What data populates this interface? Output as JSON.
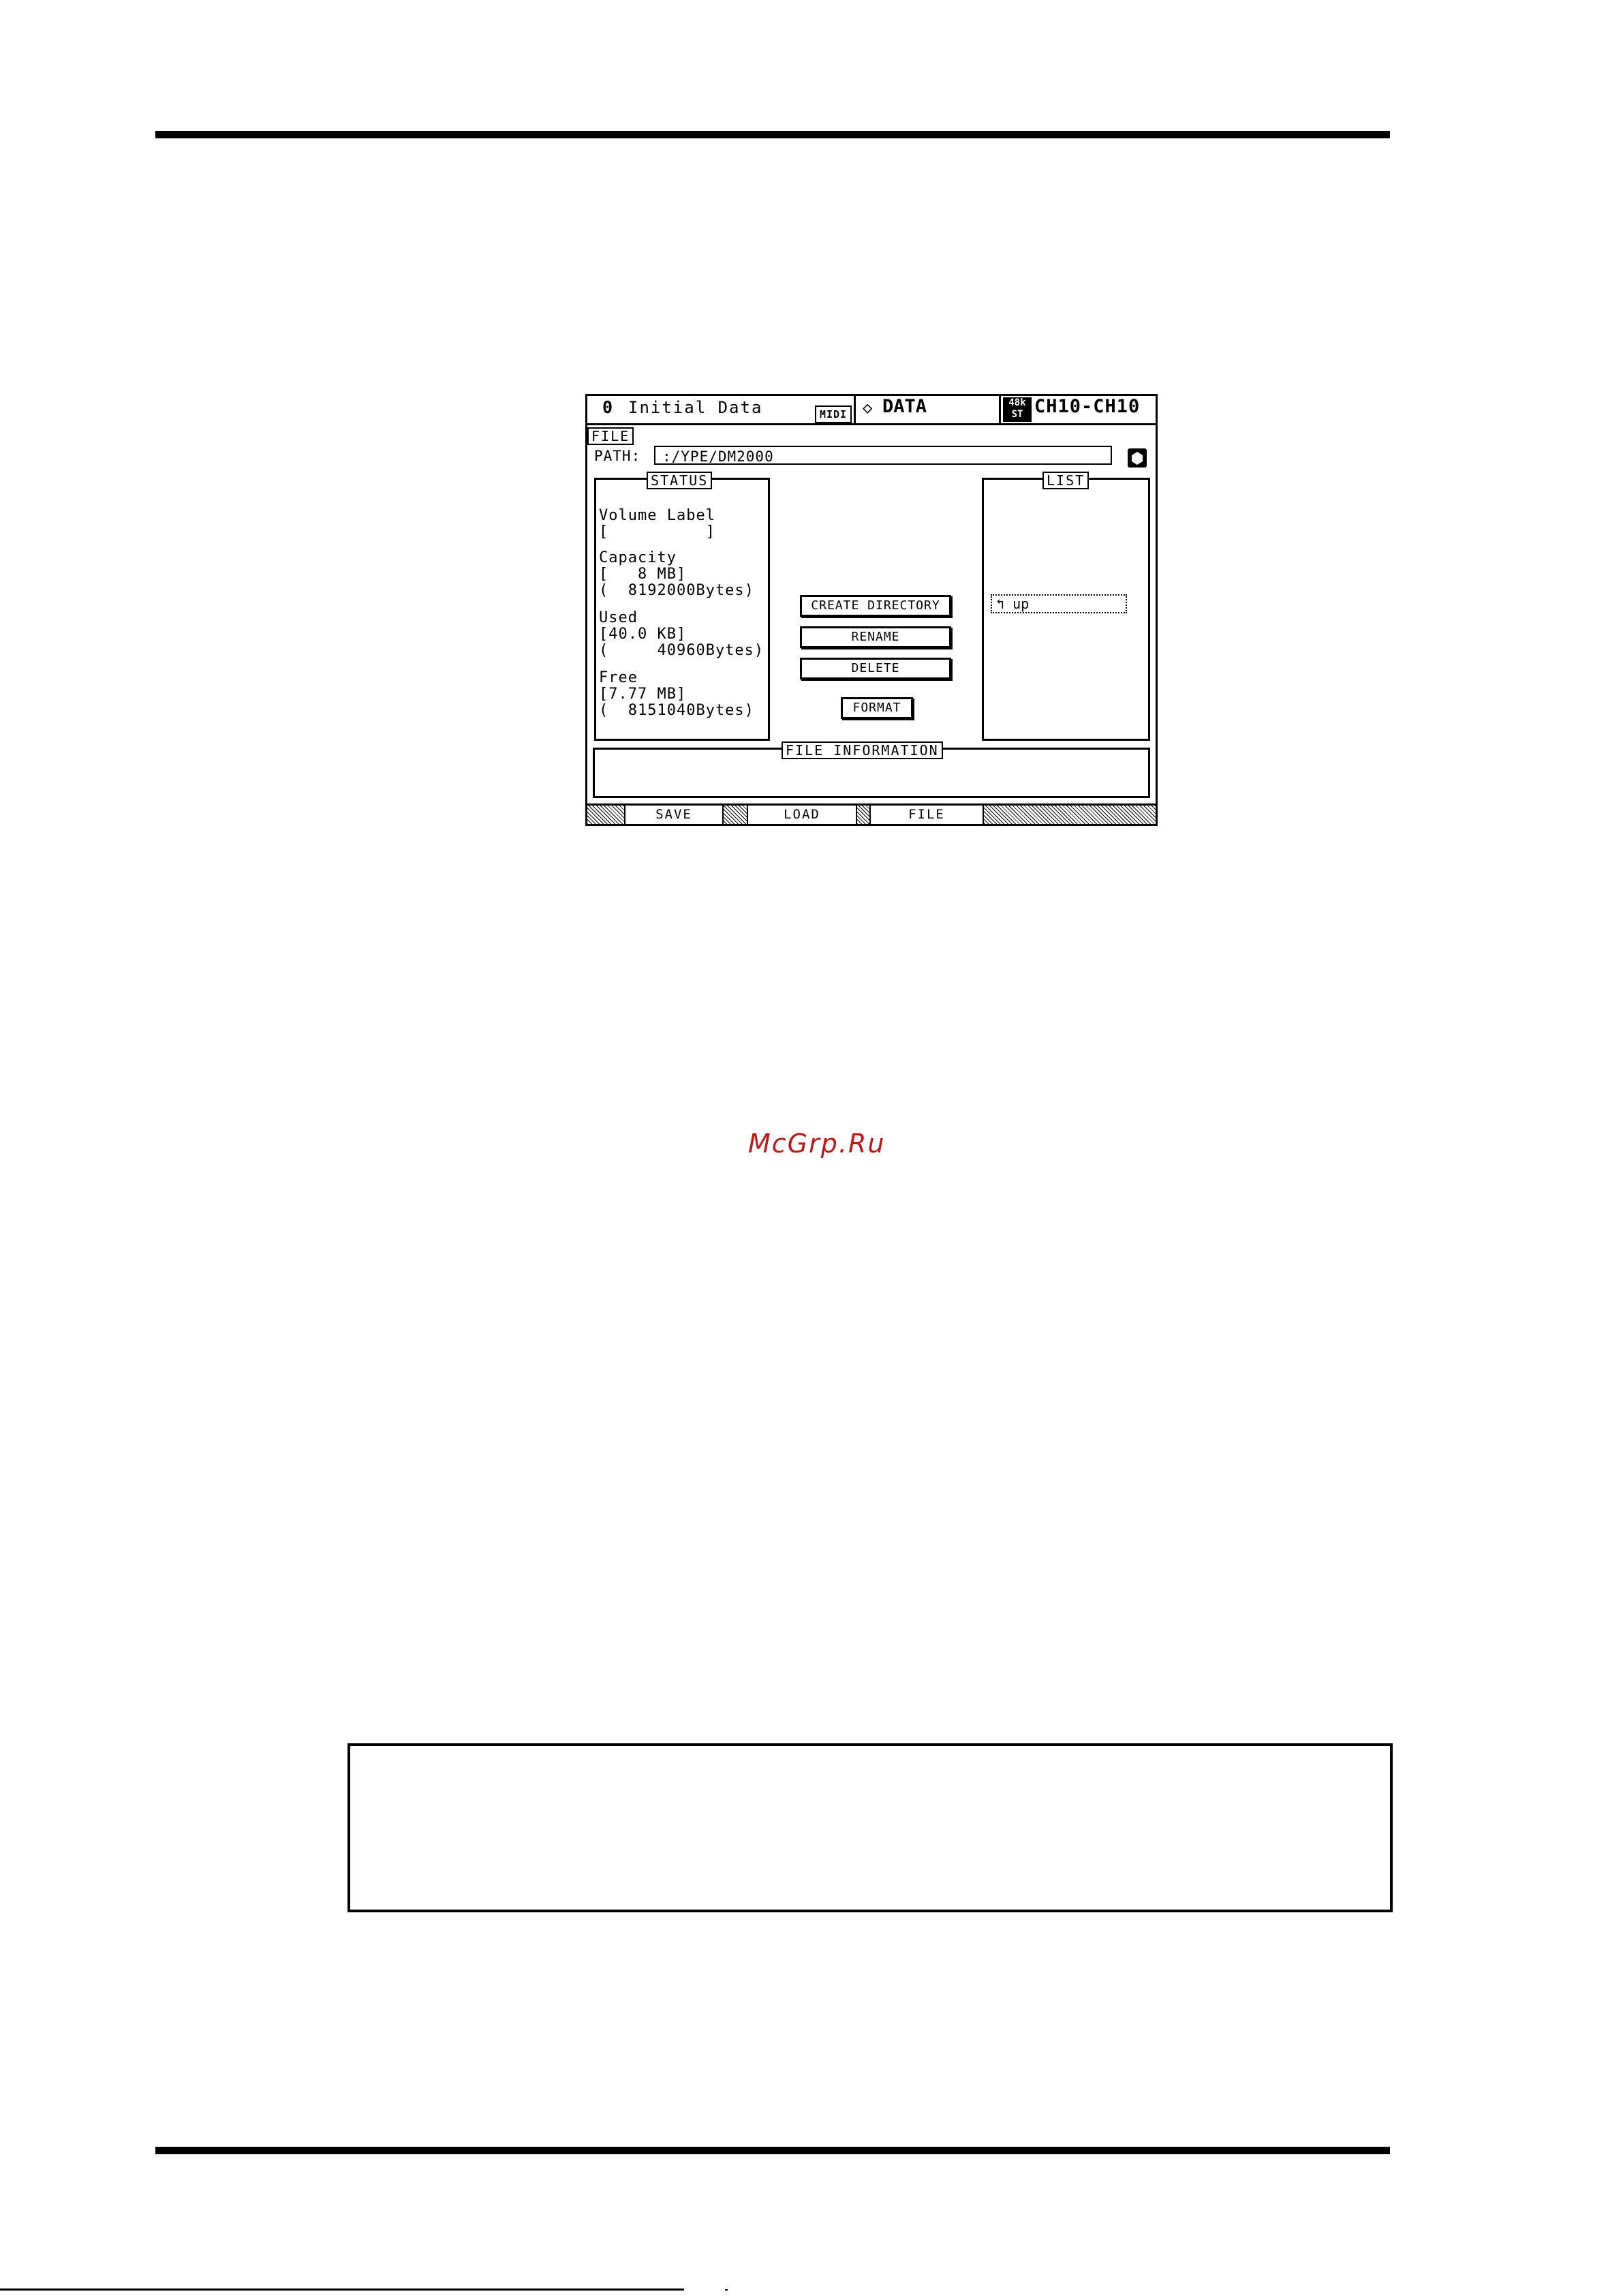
{
  "lcd": {
    "header": {
      "scene_number": "0",
      "scene_title": "Initial Data",
      "midi_badge": "MIDI",
      "diamond_icon": "◇",
      "page_title": "DATA",
      "rate_top": "48k",
      "rate_bottom": "ST",
      "channel": "CH10-CH10"
    },
    "file_tag": "FILE",
    "path_label": "PATH:",
    "path_value": ":/YPE/DM2000",
    "status": {
      "title": "STATUS",
      "lines": [
        "Volume Label",
        "[          ]",
        "Capacity",
        "[   8 MB]",
        "(  8192000Bytes)",
        "Used",
        "[40.0 KB]",
        "(     40960Bytes)",
        "Free",
        "[7.77 MB]",
        "(  8151040Bytes)"
      ]
    },
    "buttons": {
      "create": "CREATE DIRECTORY",
      "rename": "RENAME",
      "delete": "DELETE",
      "format": "FORMAT"
    },
    "list": {
      "title": "LIST",
      "items": [
        "↰ up"
      ]
    },
    "info_title": "FILE INFORMATION",
    "tabs": [
      "SAVE",
      "LOAD",
      "FILE"
    ]
  },
  "watermark": "McGrp.Ru"
}
